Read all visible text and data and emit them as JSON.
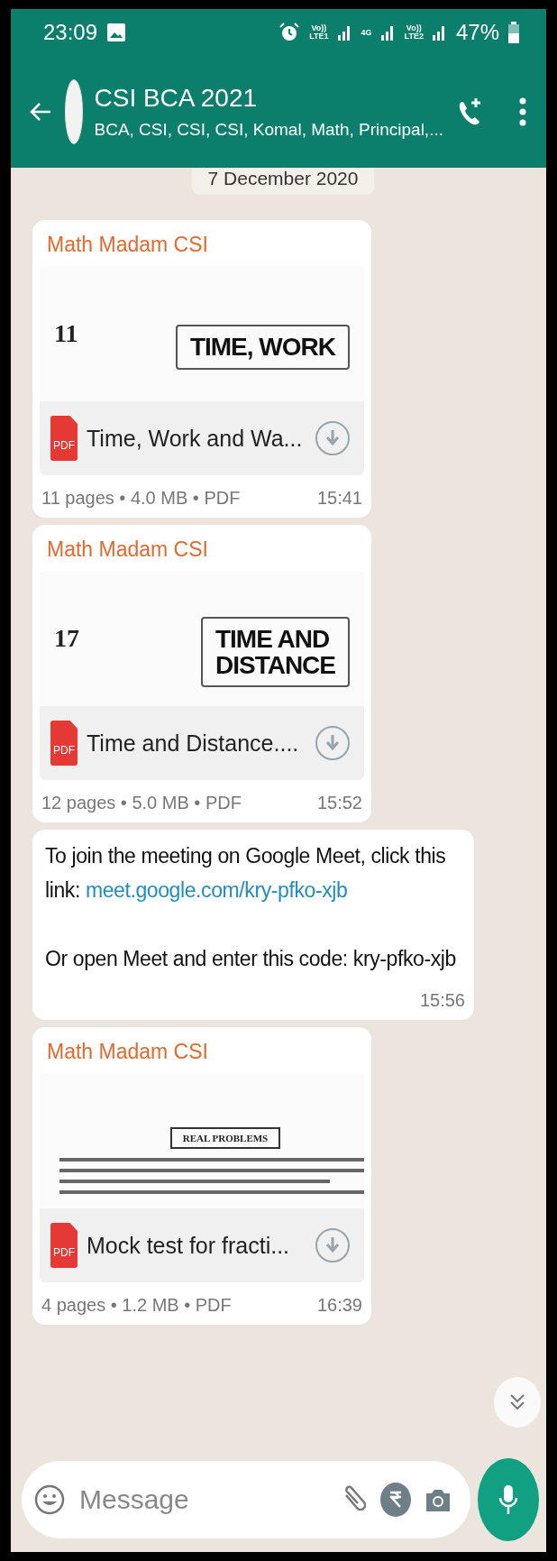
{
  "status_bar": {
    "time": "23:09",
    "signals": [
      {
        "top": "Vo))",
        "bottom": "LTE1"
      },
      {
        "top": "4G"
      },
      {
        "top": "Vo))",
        "bottom": "LTE2"
      }
    ],
    "battery": "47%"
  },
  "header": {
    "title": "CSI BCA 2021",
    "subtitle": "BCA, CSI, CSI, CSI, Komal, Math, Principal,..."
  },
  "date_chip": "7 December 2020",
  "messages": [
    {
      "kind": "document",
      "sender": "Math Madam CSI",
      "preview": {
        "kind": "chapter",
        "number": "11",
        "heading_lines": [
          "TIME, WORK"
        ]
      },
      "icon_label": "PDF",
      "file_name": "Time, Work and Wa...",
      "meta": "11 pages • 4.0 MB • PDF",
      "time": "15:41"
    },
    {
      "kind": "document",
      "sender": "Math Madam CSI",
      "preview": {
        "kind": "chapter",
        "number": "17",
        "heading_lines": [
          "TIME AND",
          "DISTANCE"
        ]
      },
      "icon_label": "PDF",
      "file_name": "Time and Distance....",
      "meta": "12 pages • 5.0 MB • PDF",
      "time": "15:52"
    },
    {
      "kind": "text",
      "paragraphs": [
        {
          "text": "To join the meeting on Google Meet, click this link: ",
          "link": "meet.google.com/kry-pfko-xjb"
        },
        {
          "text": "Or open Meet and enter this code: kry-pfko-xjb"
        }
      ],
      "time": "15:56"
    },
    {
      "kind": "document",
      "sender": "Math Madam CSI",
      "preview": {
        "kind": "worksheet",
        "heading_lines": [
          "REAL PROBLEMS"
        ]
      },
      "icon_label": "PDF",
      "file_name": "Mock test for fracti...",
      "meta": "4 pages • 1.2 MB • PDF",
      "time": "16:39"
    }
  ],
  "composer": {
    "placeholder": "Message"
  }
}
